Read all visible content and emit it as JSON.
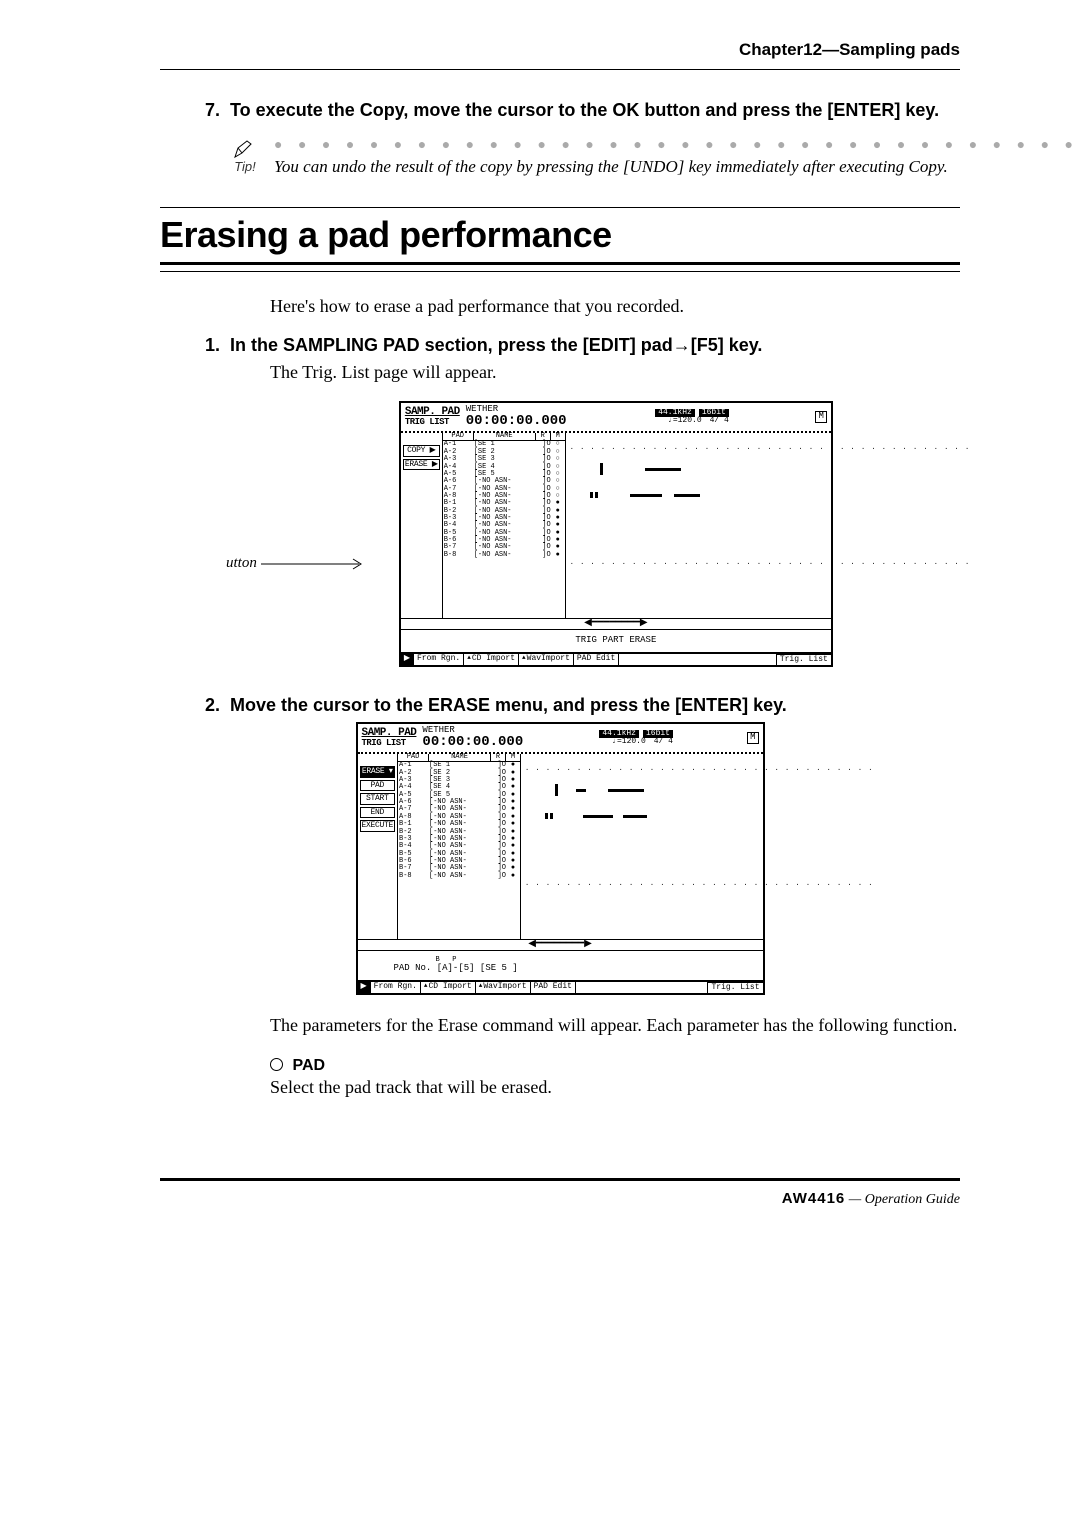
{
  "chapter": "Chapter12—Sampling pads",
  "step7": {
    "num": "7.",
    "title": "To execute the Copy, move the cursor to the OK button and press the [ENTER] key."
  },
  "tip": {
    "label": "Tip!",
    "dots": "● ● ● ● ● ● ● ● ● ● ● ● ● ● ● ● ● ● ● ● ● ● ● ● ● ● ● ● ● ● ● ● ● ● ● ● ● ● ● ● ● ● ● ●",
    "text": "You can undo the result of the copy by pressing the [UNDO] key immediately after executing Copy."
  },
  "section_title": "Erasing a pad performance",
  "intro": "Here's how to erase a pad performance that you recorded.",
  "step1": {
    "num": "1.",
    "title_prefix": "In the SAMPLING PAD section, press the [EDIT] pad",
    "title_suffix": "[F5] key.",
    "body": "The Trig. List page will appear.",
    "caption": "utton"
  },
  "step2": {
    "num": "2.",
    "title": "Move the cursor to the ERASE menu, and press the [ENTER] key.",
    "body1": "The parameters for the Erase command will appear. Each parameter has the following function.",
    "pad_head": "PAD",
    "pad_body": "Select the pad track that will be erased."
  },
  "ss1": {
    "title1": "SAMP. PAD",
    "title2": "TRIG LIST",
    "song": "WETHER",
    "time": "00:00:00.000",
    "b1": "44.1kHz",
    "b2": "16bit",
    "tempo": "♩=120.0",
    "sig": "4/ 4",
    "marker": "M",
    "head": {
      "c1": "PAD",
      "c2": "NAME",
      "c3": "R",
      "c4": "M"
    },
    "menu_copy": "COPY ▶",
    "menu_erase": "ERASE ▶",
    "cmd": "TRIG PART ERASE",
    "rows": [
      [
        "A-1",
        "[SE 1",
        "]O",
        "○"
      ],
      [
        "A-2",
        "[SE 2",
        "]O",
        "○"
      ],
      [
        "A-3",
        "[SE 3",
        "]O",
        "○"
      ],
      [
        "A-4",
        "[SE 4",
        "]O",
        "○"
      ],
      [
        "A-5",
        "[SE 5",
        "]O",
        "○"
      ],
      [
        "A-6",
        "[-NO ASN-",
        "]O",
        "○"
      ],
      [
        "A-7",
        "[-NO ASN-",
        "]O",
        "○"
      ],
      [
        "A-8",
        "[-NO ASN-",
        "]O",
        "○"
      ],
      [
        "B-1",
        "[-NO ASN-",
        "]O",
        "●"
      ],
      [
        "B-2",
        "[-NO ASN-",
        "]O",
        "●"
      ],
      [
        "B-3",
        "[-NO ASN-",
        "]O",
        "●"
      ],
      [
        "B-4",
        "[-NO ASN-",
        "]O",
        "●"
      ],
      [
        "B-5",
        "[-NO ASN-",
        "]O",
        "●"
      ],
      [
        "B-6",
        "[-NO ASN-",
        "]O",
        "●"
      ],
      [
        "B-7",
        "[-NO ASN-",
        "]O",
        "●"
      ],
      [
        "B-8",
        "[-NO ASN-",
        "]O",
        "●"
      ]
    ],
    "tabs": [
      "From Rgn.",
      "CD Import",
      "WavImport",
      "PAD Edit",
      "Trig. List"
    ]
  },
  "ss2": {
    "title1": "SAMP. PAD",
    "title2": "TRIG LIST",
    "song": "WETHER",
    "time": "00:00:00.000",
    "b1": "44.1kHz",
    "b2": "16bit",
    "tempo": "♩=120.0",
    "sig": "4/ 4",
    "marker": "M",
    "head": {
      "c1": "PAD",
      "c2": "NAME",
      "c3": "R",
      "c4": "M"
    },
    "menu_erase": "ERASE ▾",
    "menu_pad": "PAD",
    "menu_start": "START",
    "menu_end": "END",
    "menu_exec": "EXECUTE",
    "param": "PAD No. [A]-[5]   [SE 5   ]",
    "rows": [
      [
        "A-1",
        "[SE 1",
        "]O",
        "●"
      ],
      [
        "A-2",
        "[SE 2",
        "]O",
        "●"
      ],
      [
        "A-3",
        "[SE 3",
        "]O",
        "●"
      ],
      [
        "A-4",
        "[SE 4",
        "]O",
        "●"
      ],
      [
        "A-5",
        "[SE 5",
        "]O",
        "●"
      ],
      [
        "A-6",
        "[-NO ASN-",
        "]O",
        "●"
      ],
      [
        "A-7",
        "[-NO ASN-",
        "]O",
        "●"
      ],
      [
        "A-8",
        "[-NO ASN-",
        "]O",
        "●"
      ],
      [
        "B-1",
        "[-NO ASN-",
        "]O",
        "●"
      ],
      [
        "B-2",
        "[-NO ASN-",
        "]O",
        "●"
      ],
      [
        "B-3",
        "[-NO ASN-",
        "]O",
        "●"
      ],
      [
        "B-4",
        "[-NO ASN-",
        "]O",
        "●"
      ],
      [
        "B-5",
        "[-NO ASN-",
        "]O",
        "●"
      ],
      [
        "B-6",
        "[-NO ASN-",
        "]O",
        "●"
      ],
      [
        "B-7",
        "[-NO ASN-",
        "]O",
        "●"
      ],
      [
        "B-8",
        "[-NO ASN-",
        "]O",
        "●"
      ]
    ],
    "tabs": [
      "From Rgn.",
      "CD Import",
      "WavImport",
      "PAD Edit",
      "Trig. List"
    ]
  },
  "footer": {
    "model": "AW4416",
    "text": "— Operation Guide"
  }
}
